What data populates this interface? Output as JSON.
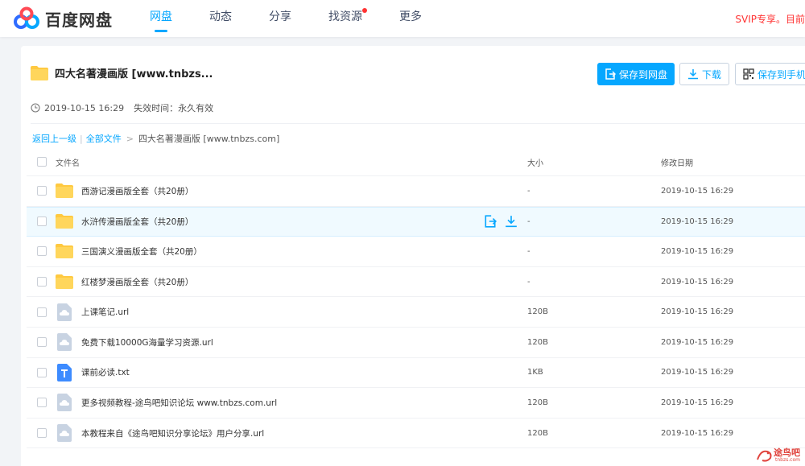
{
  "app": {
    "logo_text": "百度网盘"
  },
  "nav": {
    "items": [
      "网盘",
      "动态",
      "分享",
      "找资源",
      "更多"
    ],
    "svip": "SVIP专享。目前"
  },
  "share": {
    "title": "四大名著漫画版  [www.tnbzs...",
    "save_btn": "保存到网盘",
    "download_btn": "下载",
    "phone_btn": "保存到手机",
    "created": "2019-10-15 16:29",
    "expire_label": "失效时间：",
    "expire_value": "永久有效"
  },
  "breadcrumb": {
    "back": "返回上一级",
    "all": "全部文件",
    "current": "四大名著漫画版 [www.tnbzs.com]"
  },
  "columns": {
    "name": "文件名",
    "size": "大小",
    "date": "修改日期"
  },
  "files": [
    {
      "name": "西游记漫画版全套（共20册）",
      "size": "-",
      "date": "2019-10-15 16:29",
      "type": "folder"
    },
    {
      "name": "水浒传漫画版全套（共20册）",
      "size": "-",
      "date": "2019-10-15 16:29",
      "type": "folder"
    },
    {
      "name": "三国演义漫画版全套（共20册）",
      "size": "-",
      "date": "2019-10-15 16:29",
      "type": "folder"
    },
    {
      "name": "红楼梦漫画版全套（共20册）",
      "size": "-",
      "date": "2019-10-15 16:29",
      "type": "folder"
    },
    {
      "name": "上课笔记.url",
      "size": "120B",
      "date": "2019-10-15 16:29",
      "type": "url"
    },
    {
      "name": "免费下载10000G海量学习资源.url",
      "size": "120B",
      "date": "2019-10-15 16:29",
      "type": "url"
    },
    {
      "name": "课前必读.txt",
      "size": "1KB",
      "date": "2019-10-15 16:29",
      "type": "txt"
    },
    {
      "name": "更多视频教程-途鸟吧知识论坛 www.tnbzs.com.url",
      "size": "120B",
      "date": "2019-10-15 16:29",
      "type": "url"
    },
    {
      "name": "本教程来自《途鸟吧知识分享论坛》用户分享.url",
      "size": "120B",
      "date": "2019-10-15 16:29",
      "type": "url"
    }
  ],
  "watermark": {
    "text": "途鸟吧",
    "sub": "tnbzs.com"
  },
  "colors": {
    "accent": "#06a7ff",
    "folder": "#ffc940",
    "hover_bg": "#f0faff"
  }
}
